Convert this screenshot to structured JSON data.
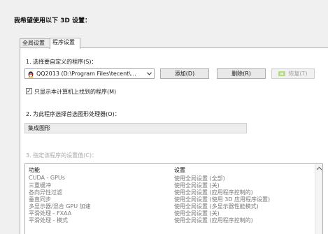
{
  "heading": "我希望使用以下 3D 设置：",
  "tabs": [
    {
      "label": "全局设置",
      "active": false
    },
    {
      "label": "程序设置",
      "active": true
    }
  ],
  "step1": {
    "label": "1. 选择要自定义的程序(S)：",
    "program_value": "QQ2013 (D:\\Program Files\\tecent\\...",
    "add_button": "添加(D)",
    "delete_button": "删除(R)",
    "restore_button": "恢复(T)",
    "checkbox_label": "只显示本计算机上找到的程序(M)",
    "checkbox_checked": true
  },
  "step2": {
    "label": "2. 为此程序选择首选图形处理器(O)：",
    "value": "集成图形"
  },
  "step3": {
    "label": "3. 指定该程序的设置值(C)：",
    "columns": [
      "功能",
      "设置"
    ],
    "rows": [
      {
        "feature": "CUDA - GPUs",
        "setting": "使用全局设置 (全部)"
      },
      {
        "feature": "三重缓冲",
        "setting": "使用全局设置 (关)"
      },
      {
        "feature": "各向异性过滤",
        "setting": "使用全局设置 (应用程序控制的)"
      },
      {
        "feature": "垂直同步",
        "setting": "使用全局设置 (使用 3D 应用程序设置)"
      },
      {
        "feature": "多显示器/混合 GPU 加速",
        "setting": "使用全局设置 (多显示器性能模式)"
      },
      {
        "feature": "平滑处理 - FXAA",
        "setting": "使用全局设置 (关)"
      },
      {
        "feature": "平滑处理 - 模式",
        "setting": "使用全局设置 (应用程序控制的)"
      }
    ]
  },
  "colors": {
    "accent_green": "#76b900",
    "dim_text": "#a8a8a8"
  }
}
